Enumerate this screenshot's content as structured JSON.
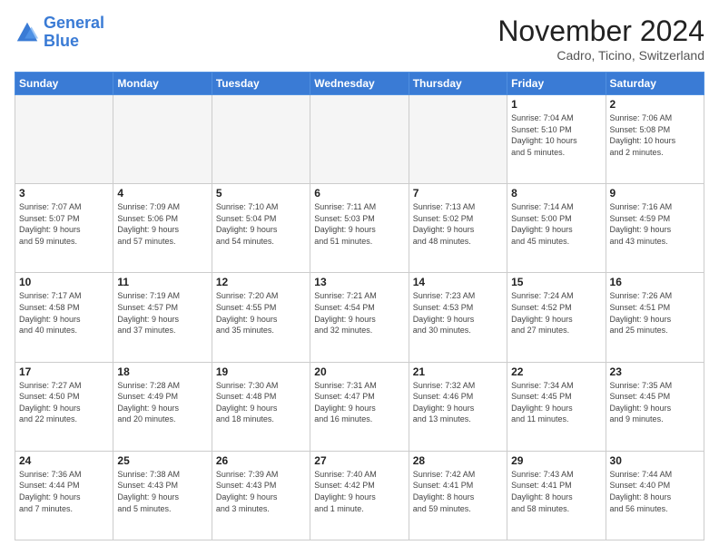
{
  "logo": {
    "line1": "General",
    "line2": "Blue"
  },
  "title": "November 2024",
  "location": "Cadro, Ticino, Switzerland",
  "weekdays": [
    "Sunday",
    "Monday",
    "Tuesday",
    "Wednesday",
    "Thursday",
    "Friday",
    "Saturday"
  ],
  "weeks": [
    [
      {
        "day": "",
        "info": ""
      },
      {
        "day": "",
        "info": ""
      },
      {
        "day": "",
        "info": ""
      },
      {
        "day": "",
        "info": ""
      },
      {
        "day": "",
        "info": ""
      },
      {
        "day": "1",
        "info": "Sunrise: 7:04 AM\nSunset: 5:10 PM\nDaylight: 10 hours\nand 5 minutes."
      },
      {
        "day": "2",
        "info": "Sunrise: 7:06 AM\nSunset: 5:08 PM\nDaylight: 10 hours\nand 2 minutes."
      }
    ],
    [
      {
        "day": "3",
        "info": "Sunrise: 7:07 AM\nSunset: 5:07 PM\nDaylight: 9 hours\nand 59 minutes."
      },
      {
        "day": "4",
        "info": "Sunrise: 7:09 AM\nSunset: 5:06 PM\nDaylight: 9 hours\nand 57 minutes."
      },
      {
        "day": "5",
        "info": "Sunrise: 7:10 AM\nSunset: 5:04 PM\nDaylight: 9 hours\nand 54 minutes."
      },
      {
        "day": "6",
        "info": "Sunrise: 7:11 AM\nSunset: 5:03 PM\nDaylight: 9 hours\nand 51 minutes."
      },
      {
        "day": "7",
        "info": "Sunrise: 7:13 AM\nSunset: 5:02 PM\nDaylight: 9 hours\nand 48 minutes."
      },
      {
        "day": "8",
        "info": "Sunrise: 7:14 AM\nSunset: 5:00 PM\nDaylight: 9 hours\nand 45 minutes."
      },
      {
        "day": "9",
        "info": "Sunrise: 7:16 AM\nSunset: 4:59 PM\nDaylight: 9 hours\nand 43 minutes."
      }
    ],
    [
      {
        "day": "10",
        "info": "Sunrise: 7:17 AM\nSunset: 4:58 PM\nDaylight: 9 hours\nand 40 minutes."
      },
      {
        "day": "11",
        "info": "Sunrise: 7:19 AM\nSunset: 4:57 PM\nDaylight: 9 hours\nand 37 minutes."
      },
      {
        "day": "12",
        "info": "Sunrise: 7:20 AM\nSunset: 4:55 PM\nDaylight: 9 hours\nand 35 minutes."
      },
      {
        "day": "13",
        "info": "Sunrise: 7:21 AM\nSunset: 4:54 PM\nDaylight: 9 hours\nand 32 minutes."
      },
      {
        "day": "14",
        "info": "Sunrise: 7:23 AM\nSunset: 4:53 PM\nDaylight: 9 hours\nand 30 minutes."
      },
      {
        "day": "15",
        "info": "Sunrise: 7:24 AM\nSunset: 4:52 PM\nDaylight: 9 hours\nand 27 minutes."
      },
      {
        "day": "16",
        "info": "Sunrise: 7:26 AM\nSunset: 4:51 PM\nDaylight: 9 hours\nand 25 minutes."
      }
    ],
    [
      {
        "day": "17",
        "info": "Sunrise: 7:27 AM\nSunset: 4:50 PM\nDaylight: 9 hours\nand 22 minutes."
      },
      {
        "day": "18",
        "info": "Sunrise: 7:28 AM\nSunset: 4:49 PM\nDaylight: 9 hours\nand 20 minutes."
      },
      {
        "day": "19",
        "info": "Sunrise: 7:30 AM\nSunset: 4:48 PM\nDaylight: 9 hours\nand 18 minutes."
      },
      {
        "day": "20",
        "info": "Sunrise: 7:31 AM\nSunset: 4:47 PM\nDaylight: 9 hours\nand 16 minutes."
      },
      {
        "day": "21",
        "info": "Sunrise: 7:32 AM\nSunset: 4:46 PM\nDaylight: 9 hours\nand 13 minutes."
      },
      {
        "day": "22",
        "info": "Sunrise: 7:34 AM\nSunset: 4:45 PM\nDaylight: 9 hours\nand 11 minutes."
      },
      {
        "day": "23",
        "info": "Sunrise: 7:35 AM\nSunset: 4:45 PM\nDaylight: 9 hours\nand 9 minutes."
      }
    ],
    [
      {
        "day": "24",
        "info": "Sunrise: 7:36 AM\nSunset: 4:44 PM\nDaylight: 9 hours\nand 7 minutes."
      },
      {
        "day": "25",
        "info": "Sunrise: 7:38 AM\nSunset: 4:43 PM\nDaylight: 9 hours\nand 5 minutes."
      },
      {
        "day": "26",
        "info": "Sunrise: 7:39 AM\nSunset: 4:43 PM\nDaylight: 9 hours\nand 3 minutes."
      },
      {
        "day": "27",
        "info": "Sunrise: 7:40 AM\nSunset: 4:42 PM\nDaylight: 9 hours\nand 1 minute."
      },
      {
        "day": "28",
        "info": "Sunrise: 7:42 AM\nSunset: 4:41 PM\nDaylight: 8 hours\nand 59 minutes."
      },
      {
        "day": "29",
        "info": "Sunrise: 7:43 AM\nSunset: 4:41 PM\nDaylight: 8 hours\nand 58 minutes."
      },
      {
        "day": "30",
        "info": "Sunrise: 7:44 AM\nSunset: 4:40 PM\nDaylight: 8 hours\nand 56 minutes."
      }
    ]
  ]
}
